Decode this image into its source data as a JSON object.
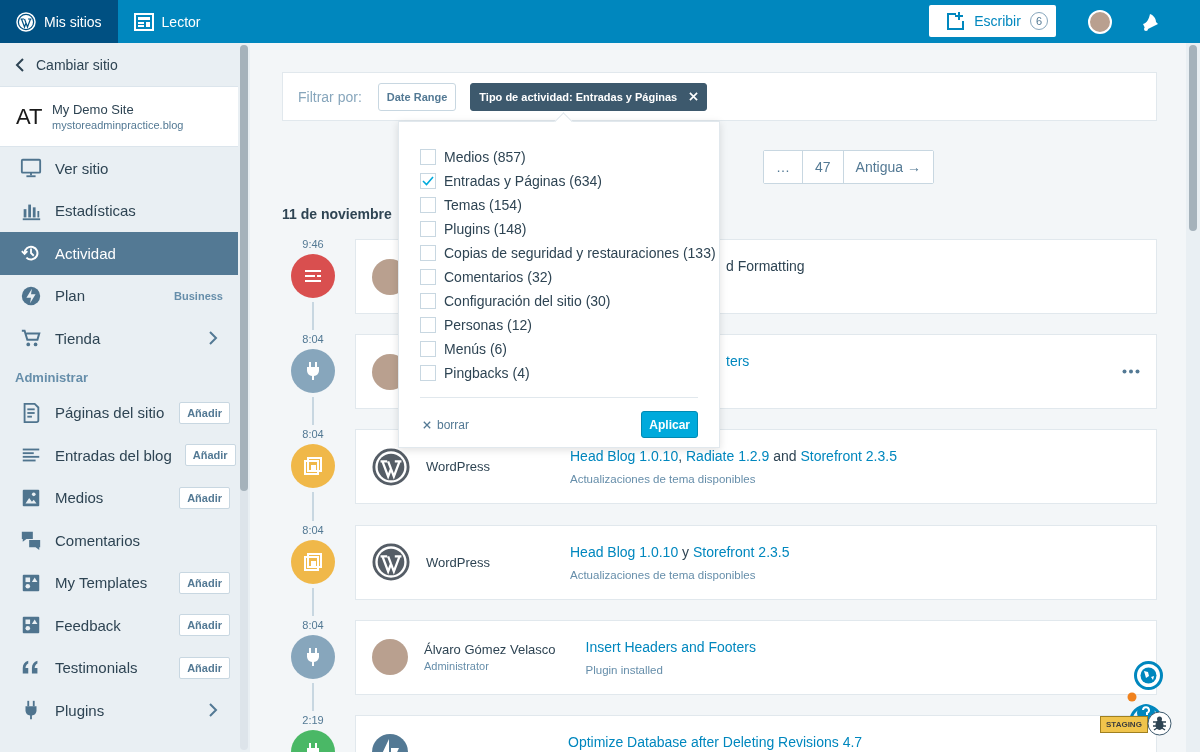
{
  "topbar": {
    "my_sites": "Mis sitios",
    "reader": "Lector",
    "write": "Escribir",
    "write_count": "6"
  },
  "sidebar": {
    "switch_site": "Cambiar sitio",
    "site": {
      "initials": "AT",
      "name": "My Demo Site",
      "url": "mystoreadminpractice.blog"
    },
    "menu": [
      {
        "kind": "view",
        "label": "Ver sitio",
        "selected": false,
        "has_submenu": false
      },
      {
        "kind": "stats",
        "label": "Estadísticas",
        "selected": false,
        "has_submenu": false
      },
      {
        "kind": "activity",
        "label": "Actividad",
        "selected": true,
        "has_submenu": false
      },
      {
        "kind": "plan",
        "label": "Plan",
        "badge": "Business",
        "selected": false,
        "has_submenu": false
      },
      {
        "kind": "store",
        "label": "Tienda",
        "selected": false,
        "has_submenu": true
      }
    ],
    "manage_heading": "Administrar",
    "manage_menu": [
      {
        "kind": "pages",
        "label": "Páginas del sitio",
        "add": "Añadir",
        "selected": false,
        "has_submenu": false
      },
      {
        "kind": "posts",
        "label": "Entradas del blog",
        "add": "Añadir",
        "selected": false,
        "has_submenu": false
      },
      {
        "kind": "media",
        "label": "Medios",
        "add": "Añadir",
        "selected": false,
        "has_submenu": false
      },
      {
        "kind": "comments",
        "label": "Comentarios",
        "selected": false,
        "has_submenu": false
      },
      {
        "kind": "block",
        "label": "My Templates",
        "add": "Añadir",
        "selected": false,
        "has_submenu": false
      },
      {
        "kind": "block",
        "label": "Feedback",
        "add": "Añadir",
        "selected": false,
        "has_submenu": false
      },
      {
        "kind": "quote",
        "label": "Testimonials",
        "add": "Añadir",
        "selected": false,
        "has_submenu": false
      },
      {
        "kind": "plugin",
        "label": "Plugins",
        "selected": false,
        "has_submenu": true
      }
    ]
  },
  "filter": {
    "label": "Filtrar por:",
    "buttons": [
      {
        "label": "Date Range",
        "active": false
      },
      {
        "label": "Tipo de actividad: Entradas y Páginas",
        "active": true
      }
    ]
  },
  "popover": {
    "options": [
      {
        "label": "Medios (857)",
        "checked": false
      },
      {
        "label": "Entradas y Páginas (634)",
        "checked": true
      },
      {
        "label": "Temas (154)",
        "checked": false
      },
      {
        "label": "Plugins (148)",
        "checked": false
      },
      {
        "label": "Copias de seguridad y restauraciones (133)",
        "checked": false
      },
      {
        "label": "Comentarios (32)",
        "checked": false
      },
      {
        "label": "Configuración del sitio (30)",
        "checked": false
      },
      {
        "label": "Personas (12)",
        "checked": false
      },
      {
        "label": "Menús (6)",
        "checked": false
      },
      {
        "label": "Pingbacks (4)",
        "checked": false
      }
    ],
    "clear": "borrar",
    "apply": "Aplicar"
  },
  "pagination": [
    "…",
    "47",
    "Antigua →"
  ],
  "date": "11 de noviembre",
  "events": [
    {
      "time": "9:46",
      "kind": "post",
      "color": "#d94f4f",
      "actor": {
        "kind": "avatar"
      },
      "title": [
        {
          "text": "d Formatting",
          "link": false
        }
      ],
      "has_menu": false
    },
    {
      "time": "8:04",
      "kind": "plugin",
      "color": "#87a6bc",
      "actor": {
        "kind": "avatar"
      },
      "title": [
        {
          "text": "ters",
          "link": true
        }
      ],
      "has_menu": true
    },
    {
      "time": "8:04",
      "kind": "theme",
      "color": "#f0b849",
      "actor": {
        "kind": "wordpress",
        "name": "WordPress"
      },
      "title": [
        {
          "text": "Head Blog 1.0.10",
          "link": true
        },
        {
          "text": ", ",
          "link": false
        },
        {
          "text": "Radiate 1.2.9",
          "link": true
        },
        {
          "text": " and ",
          "link": false
        },
        {
          "text": "Storefront 2.3.5",
          "link": true
        }
      ],
      "subtitle": "Actualizaciones de tema disponibles",
      "has_menu": false
    },
    {
      "time": "8:04",
      "kind": "theme",
      "color": "#f0b849",
      "actor": {
        "kind": "wordpress",
        "name": "WordPress"
      },
      "title": [
        {
          "text": "Head Blog 1.0.10",
          "link": true
        },
        {
          "text": " y ",
          "link": false
        },
        {
          "text": "Storefront 2.3.5",
          "link": true
        }
      ],
      "subtitle": "Actualizaciones de tema disponibles",
      "has_menu": false
    },
    {
      "time": "8:04",
      "kind": "plugin",
      "color": "#87a6bc",
      "actor": {
        "kind": "avatar",
        "name": "Álvaro Gómez Velasco",
        "role": "Administrator"
      },
      "title": [
        {
          "text": "Insert Headers and Footers",
          "link": true
        }
      ],
      "subtitle": "Plugin installed",
      "has_menu": false
    },
    {
      "time": "2:19",
      "kind": "plugin",
      "color": "#4ab866",
      "actor": {
        "kind": "jetpack"
      },
      "title": [
        {
          "text": "Optimize Database after Deleting Revisions 4.7",
          "link": true
        }
      ],
      "has_menu": false
    }
  ],
  "staging_label": "STAGING"
}
